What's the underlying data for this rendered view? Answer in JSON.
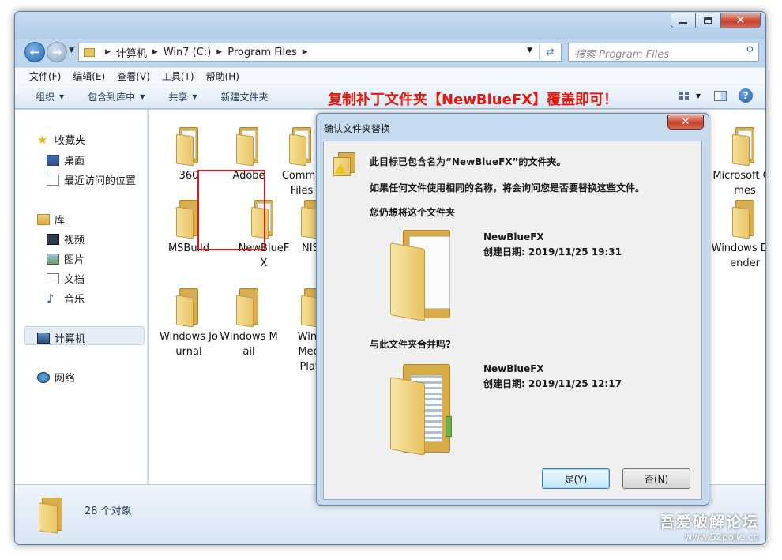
{
  "window": {
    "caption": {
      "minimize": "minimize",
      "maximize": "maximize",
      "close": "✕"
    }
  },
  "address": {
    "crumbs": [
      "计算机",
      "Win7 (C:)",
      "Program Files"
    ],
    "search_placeholder": "搜索 Program Files"
  },
  "menu": [
    "文件(F)",
    "编辑(E)",
    "查看(V)",
    "工具(T)",
    "帮助(H)"
  ],
  "commands": {
    "organize": "组织",
    "include_library": "包含到库中",
    "share": "共享",
    "new_folder": "新建文件夹"
  },
  "annotation": "复制补丁文件夹【NewBlueFX】覆盖即可！",
  "nav_pane": {
    "favorites": "收藏夹",
    "desktop": "桌面",
    "recent": "最近访问的位置",
    "libraries": "库",
    "videos": "视频",
    "pictures": "图片",
    "documents": "文档",
    "music": "音乐",
    "computer": "计算机",
    "network": "网络"
  },
  "files": [
    {
      "name": "360"
    },
    {
      "name": "Adobe"
    },
    {
      "name": "Commo Files"
    },
    {
      "name": "MSBuild"
    },
    {
      "name": "NewBlueFX"
    },
    {
      "name": "NISE"
    },
    {
      "name": "Windows Journal"
    },
    {
      "name": "Windows Mail"
    },
    {
      "name": "Windo Media Playe"
    },
    {
      "name": "Microsoft Games"
    },
    {
      "name": "Windows Defender"
    }
  ],
  "status": {
    "count": "28 个对象"
  },
  "watermark": {
    "line1": "吾爱破解论坛",
    "line2": "www.52pojie.cn"
  },
  "dialog": {
    "title": "确认文件夹替换",
    "close": "✕",
    "message1": "此目标已包含名为“NewBlueFX”的文件夹。",
    "message2": "如果任何文件使用相同的名称，将会询问您是否要替换这些文件。",
    "question1": "您仍想将这个文件夹",
    "source": {
      "name": "NewBlueFX",
      "created": "创建日期: 2019/11/25 19:31"
    },
    "question2": "与此文件夹合并吗?",
    "target": {
      "name": "NewBlueFX",
      "created": "创建日期: 2019/11/25 12:17"
    },
    "yes": "是(Y)",
    "no": "否(N)"
  }
}
